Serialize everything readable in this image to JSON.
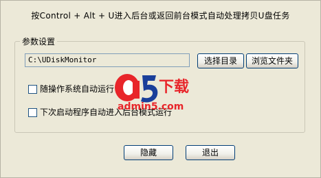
{
  "header": {
    "instruction": "按Control + Alt + U进入后台或返回前台模式自动处理拷贝U盘任务"
  },
  "settings": {
    "group_title": "参数设置",
    "path_value": "C:\\UDiskMonitor",
    "browse_dir_label": "选择目录",
    "open_folder_label": "浏览文件夹",
    "checkbox_autostart_label": "随操作系统自动运行",
    "checkbox_autostart_checked": false,
    "checkbox_background_label": "下次启动程序自动进入后台模式运行",
    "checkbox_background_checked": false
  },
  "footer": {
    "hide_label": "隐藏",
    "exit_label": "退出"
  },
  "watermark": {
    "brand": "a5下载",
    "url": "admin5.com",
    "colors": {
      "red": "#e8252a",
      "blue": "#1a3f9a"
    }
  }
}
